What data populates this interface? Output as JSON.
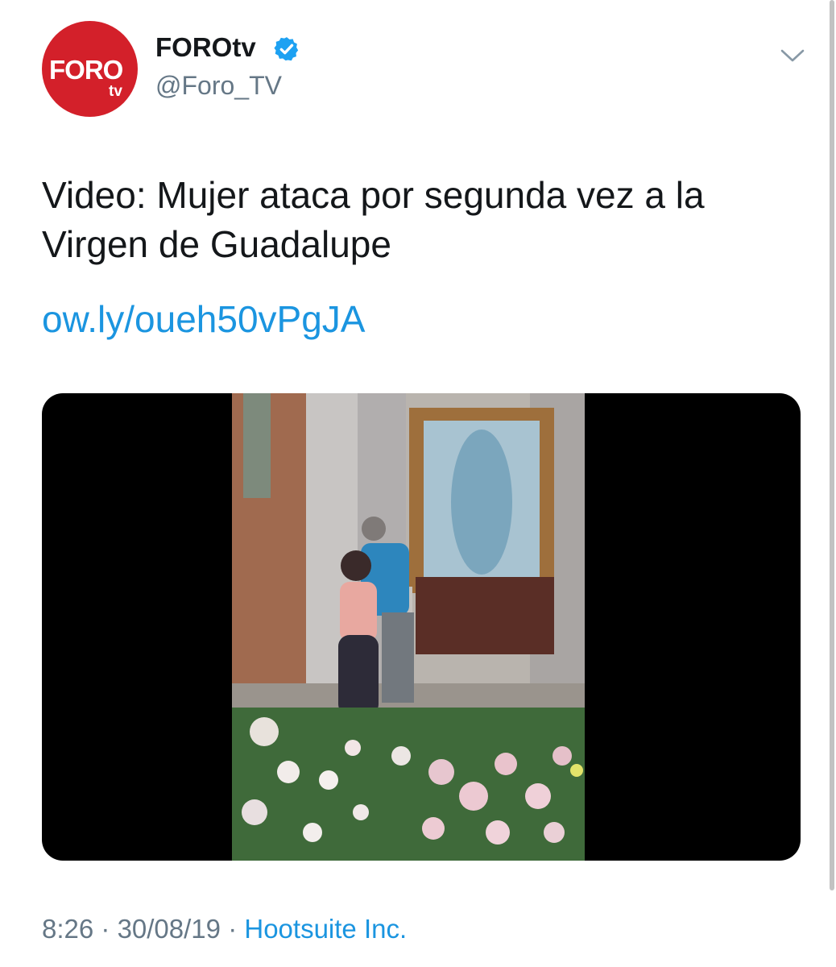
{
  "author": {
    "avatar_text": "FORO",
    "avatar_subtext": "tv",
    "display_name": "FOROtv",
    "handle": "@Foro_TV",
    "verified_icon": "verified-badge-icon",
    "brand_color": "#d3202a"
  },
  "menu": {
    "icon": "chevron-down-icon"
  },
  "tweet": {
    "text": "Video: Mujer ataca por segunda vez a la Virgen de Guadalupe",
    "link": "ow.ly/oueh50vPgJA"
  },
  "media": {
    "type": "video"
  },
  "meta": {
    "time": "8:26",
    "separator1": " · ",
    "date": "30/08/19",
    "separator2": " · ",
    "source": "Hootsuite Inc."
  },
  "colors": {
    "text": "#14171a",
    "secondary": "#657786",
    "link": "#1b95e0",
    "verified": "#1da1f2"
  }
}
